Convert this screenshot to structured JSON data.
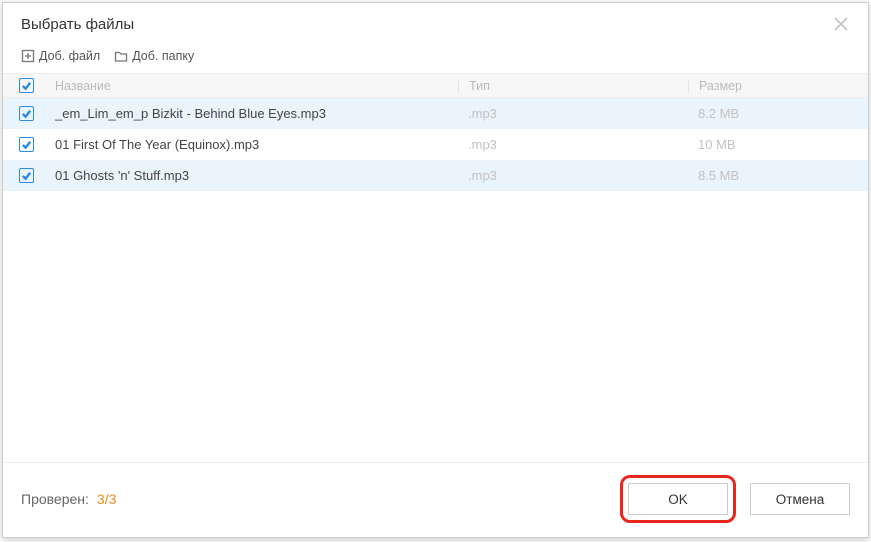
{
  "dialog": {
    "title": "Выбрать файлы"
  },
  "toolbar": {
    "add_file": "Доб. файл",
    "add_folder": "Доб. папку"
  },
  "columns": {
    "name": "Название",
    "type": "Тип",
    "size": "Размер"
  },
  "files": [
    {
      "name": "_em_Lim_em_p Bizkit - Behind Blue Eyes.mp3",
      "type": ".mp3",
      "size": "8.2 MB",
      "checked": true
    },
    {
      "name": "01 First Of The Year (Equinox).mp3",
      "type": ".mp3",
      "size": "10 MB",
      "checked": true
    },
    {
      "name": "01 Ghosts 'n' Stuff.mp3",
      "type": ".mp3",
      "size": "8.5 MB",
      "checked": true
    }
  ],
  "footer": {
    "status_label": "Проверен:",
    "status_count": "3/3",
    "ok": "OK",
    "cancel": "Отмена"
  }
}
